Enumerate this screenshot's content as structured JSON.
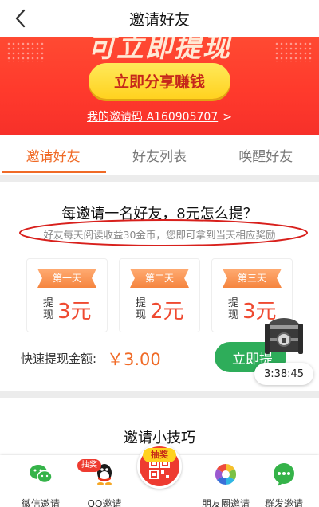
{
  "header": {
    "title": "邀请好友"
  },
  "banner": {
    "headline": "可立即提现",
    "share_button": "立即分享赚钱",
    "invite_code": "我的邀请码 A160905707"
  },
  "tabs": [
    {
      "label": "邀请好友",
      "active": true
    },
    {
      "label": "好友列表",
      "active": false
    },
    {
      "label": "唤醒好友",
      "active": false
    }
  ],
  "rules": {
    "title": "每邀请一名好友，8元怎么提？",
    "subtitle": "好友每天阅读收益30金币，您即可拿到当天相应奖励",
    "days": [
      {
        "day_label": "第一天",
        "withdraw_label": "提现",
        "amount": "3元"
      },
      {
        "day_label": "第二天",
        "withdraw_label": "提现",
        "amount": "2元"
      },
      {
        "day_label": "第三天",
        "withdraw_label": "提现",
        "amount": "3元"
      }
    ],
    "quick_label": "快速提现金额:",
    "quick_amount": "￥3.00",
    "withdraw_button": "立即提"
  },
  "floating": {
    "timer": "3:38:45"
  },
  "tips": {
    "title": "邀请小技巧"
  },
  "bottom_bar": {
    "items": [
      {
        "label": "微信邀请",
        "icon": "wechat-icon"
      },
      {
        "label": "QQ邀请",
        "icon": "qq-icon",
        "badge": "抽奖"
      },
      {
        "label": "",
        "icon": "qr-code-icon",
        "badge": "抽奖"
      },
      {
        "label": "朋友圈邀请",
        "icon": "moments-icon"
      },
      {
        "label": "群发邀请",
        "icon": "group-chat-icon"
      }
    ]
  },
  "colors": {
    "accent": "#f06a26",
    "banner_red": "#ff3a2c",
    "green": "#2ead5a",
    "amount_red": "#ef4a31"
  }
}
